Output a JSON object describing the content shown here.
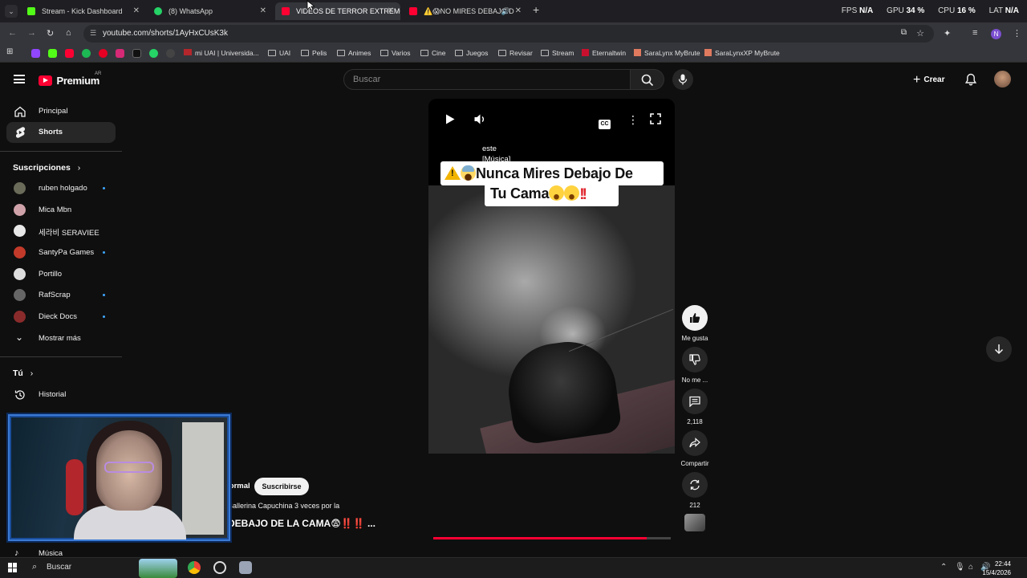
{
  "browser": {
    "tabs": [
      {
        "label": "Stream - Kick Dashboard",
        "active": false,
        "color": "#53fc18"
      },
      {
        "label": "(8) WhatsApp",
        "active": false,
        "color": "#25d366"
      },
      {
        "label": "VIDEOS DE TERROR EXTREMO",
        "active": true,
        "color": "#ff0033"
      },
      {
        "label": "⚠️😱NO MIRES DEBAJO D",
        "active": false,
        "color": "#ff0033"
      }
    ],
    "url": "youtube.com/shorts/1AyHxCUsK3k",
    "bookmarks": [
      "mi UAI | Universida...",
      "UAI",
      "Pelis",
      "Animes",
      "Varios",
      "Cine",
      "Juegos",
      "Revisar",
      "Stream",
      "Eternaltwin",
      "SaraLynx MyBrute",
      "SaraLynxXP MyBrute"
    ]
  },
  "overlay_stats": {
    "fps_label": "FPS",
    "fps_value": "N/A",
    "gpu_label": "GPU",
    "gpu_value": "34 %",
    "cpu_label": "CPU",
    "cpu_value": "16 %",
    "lat_label": "LAT",
    "lat_value": "N/A"
  },
  "youtube": {
    "logo_text": "Premium",
    "country_code": "AR",
    "search_placeholder": "Buscar",
    "create_label": "Crear"
  },
  "sidebar": {
    "items": [
      {
        "label": "Principal",
        "icon": "home-icon",
        "active": false
      },
      {
        "label": "Shorts",
        "icon": "shorts-icon",
        "active": true
      }
    ],
    "subscriptions_heading": "Suscripciones",
    "subscriptions": [
      {
        "name": "ruben holgado",
        "dot": true,
        "color": "#6b6b5a"
      },
      {
        "name": "Mica Mbn",
        "dot": false,
        "color": "#cfa2a9"
      },
      {
        "name": "세라비 SERAVIEE",
        "dot": false,
        "color": "#e8e8e8"
      },
      {
        "name": "SantyPa Games",
        "dot": true,
        "color": "#c23a2a"
      },
      {
        "name": "Portillo",
        "dot": false,
        "color": "#dddddd"
      },
      {
        "name": "RafScrap",
        "dot": true,
        "color": "#666666"
      },
      {
        "name": "Dieck Docs",
        "dot": true,
        "color": "#8a2b2b"
      }
    ],
    "show_more": "Mostrar más",
    "you_heading": "Tú",
    "history": "Historial",
    "music": "Música"
  },
  "short": {
    "caption_word": "este",
    "caption_music": "[Música]",
    "title_line1": "Nunca Mires Debajo De",
    "title_line2": "Tu Cama",
    "channel": "normal",
    "subscribe_label": "Suscribirse",
    "description": "Ballerina Capuchina 3 veces por la",
    "video_title": "DEBAJO DE LA CAMA😨‼️‼️ ...",
    "progress_fraction": 0.9
  },
  "actions": [
    {
      "label": "Me gusta",
      "icon": "thumbs-up-icon"
    },
    {
      "label": "No me ...",
      "icon": "thumbs-down-icon"
    },
    {
      "label": "2,118",
      "icon": "comment-icon"
    },
    {
      "label": "Compartir",
      "icon": "share-icon"
    },
    {
      "label": "212",
      "icon": "remix-icon"
    }
  ],
  "taskbar": {
    "search_label": "Buscar",
    "time": "22:44",
    "date": "15/4/2026"
  },
  "colors": {
    "accent": "#ff0033",
    "background": "#0f0f0f",
    "subscription_dot": "#3ea6ff"
  }
}
